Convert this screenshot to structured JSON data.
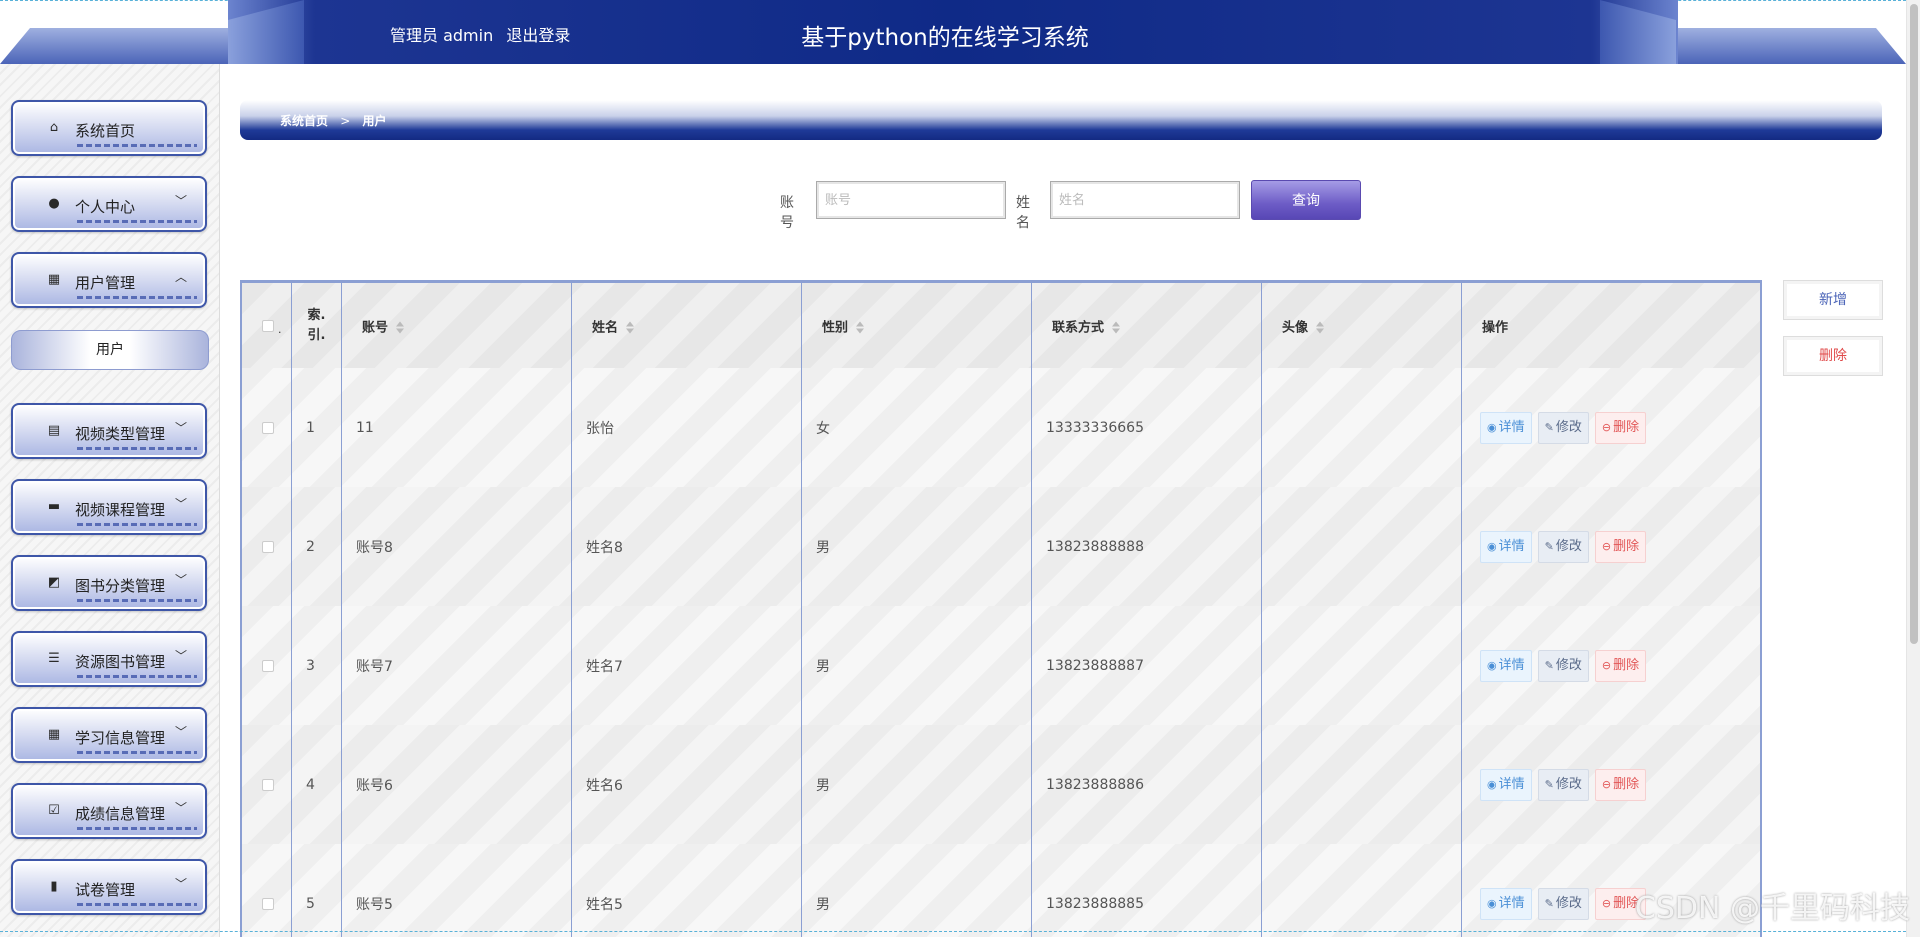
{
  "header": {
    "role_label": "管理员 admin",
    "logout_label": "退出登录",
    "title": "基于python的在线学习系统"
  },
  "sidebar": {
    "items": [
      {
        "label": "系统首页",
        "icon": "home-icon"
      },
      {
        "label": "个人中心",
        "icon": "user-icon"
      },
      {
        "label": "用户管理",
        "icon": "grid-icon"
      },
      {
        "label": "视频类型管理",
        "icon": "clipboard-icon"
      },
      {
        "label": "视频课程管理",
        "icon": "video-icon"
      },
      {
        "label": "图书分类管理",
        "icon": "chart-icon"
      },
      {
        "label": "资源图书管理",
        "icon": "list-icon"
      },
      {
        "label": "学习信息管理",
        "icon": "grid-icon"
      },
      {
        "label": "成绩信息管理",
        "icon": "check-clipboard-icon"
      },
      {
        "label": "试卷管理",
        "icon": "bar-chart-icon"
      }
    ],
    "sub_item": "用户"
  },
  "breadcrumb": {
    "home": "系统首页",
    "separator": ">",
    "current": "用户"
  },
  "search": {
    "account_label": "账号",
    "account_placeholder": "账号",
    "name_label": "姓名",
    "name_placeholder": "姓名",
    "query_button": "查询"
  },
  "actions": {
    "add": "新增",
    "delete": "删除"
  },
  "table": {
    "headers": {
      "checkbox_marker": ".",
      "index_line1": "索.",
      "index_line2": "引.",
      "account": "账号",
      "name": "姓名",
      "gender": "性别",
      "contact": "联系方式",
      "avatar": "头像",
      "operations": "操作"
    },
    "op_labels": {
      "detail": "详情",
      "edit": "修改",
      "remove": "删除"
    },
    "rows": [
      {
        "index": "1",
        "account": "11",
        "name": "张怡",
        "gender": "女",
        "contact": "13333336665"
      },
      {
        "index": "2",
        "account": "账号8",
        "name": "姓名8",
        "gender": "男",
        "contact": "13823888888"
      },
      {
        "index": "3",
        "account": "账号7",
        "name": "姓名7",
        "gender": "男",
        "contact": "13823888887"
      },
      {
        "index": "4",
        "account": "账号6",
        "name": "姓名6",
        "gender": "男",
        "contact": "13823888886"
      },
      {
        "index": "5",
        "account": "账号5",
        "name": "姓名5",
        "gender": "男",
        "contact": "13823888885"
      }
    ]
  },
  "watermark": "CSDN @千里码科技"
}
